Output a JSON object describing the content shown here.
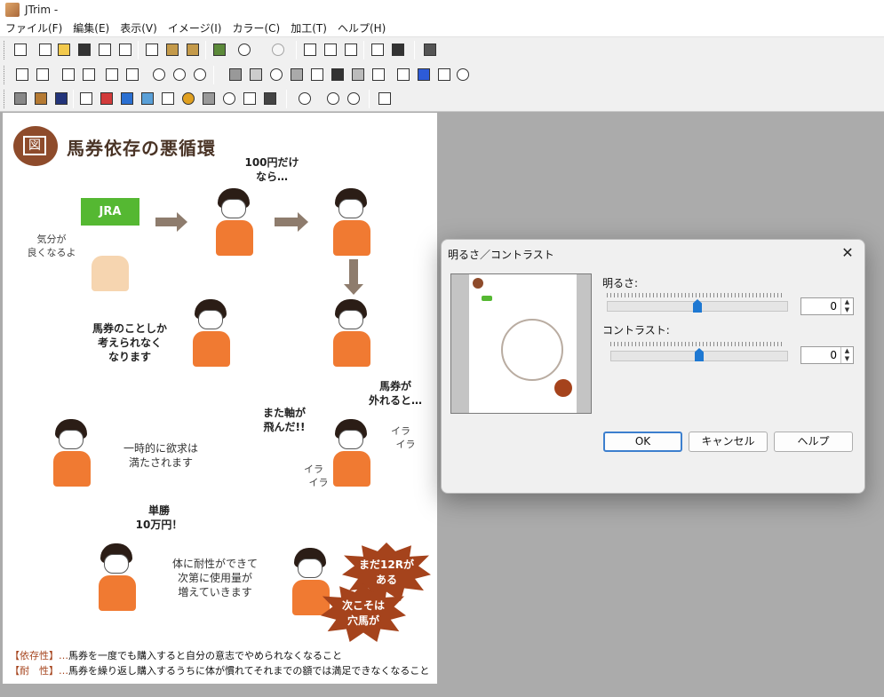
{
  "app": {
    "title": "JTrim -"
  },
  "menu": [
    "ファイル(F)",
    "編集(E)",
    "表示(V)",
    "イメージ(I)",
    "カラー(C)",
    "加工(T)",
    "ヘルプ(H)"
  ],
  "document": {
    "heading": "馬券依存の悪循環",
    "badge": "図",
    "jra": "JRA",
    "texts": {
      "kibun": "気分が\n良くなるよ",
      "hyakuen": "100円だけ\nなら…",
      "bakenNoKoto": "馬券のことしか\n考えられなく\nなります",
      "hazureru": "馬券が\n外れると…",
      "mataJiku": "また軸が\n飛んだ!!",
      "ichijiteki": "一時的に欲求は\n満たされます",
      "tansho": "単勝\n10万円！",
      "taisei": "体に耐性ができて\n次第に使用量が\n増えていきます",
      "ira1": "イラ\n　イラ",
      "ira2": "イラ\n　イラ",
      "burst1": "まだ12Rが\nある",
      "burst2": "次こそは\n穴馬が"
    },
    "footnotes": [
      {
        "key": "【依存性】…",
        "text": "馬券を一度でも購入すると自分の意志でやめられなくなること"
      },
      {
        "key": "【耐　性】…",
        "text": "馬券を繰り返し購入するうちに体が慣れてそれまでの額では満足できなくなること"
      }
    ]
  },
  "dialog": {
    "title": "明るさ／コントラスト",
    "close": "✕",
    "brightness_label": "明るさ:",
    "brightness_value": "0",
    "contrast_label": "コントラスト:",
    "contrast_value": "0",
    "slider_position": 0.5,
    "ok": "OK",
    "cancel": "キャンセル",
    "help": "ヘルプ"
  },
  "colors": {
    "accent": "#1e78d2",
    "shirt": "#f07a32",
    "badge": "#8e4b2b"
  }
}
